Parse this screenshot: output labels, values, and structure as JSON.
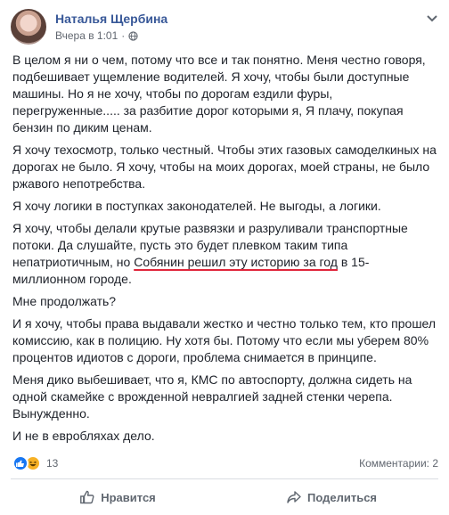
{
  "post": {
    "author": "Наталья Щербина",
    "time": "Вчера в 1:01",
    "separator": "·",
    "paragraphs": [
      "В целом я ни о чем, потому что все и так понятно. Меня честно говоря, подбешивает ущемление водителей. Я хочу, чтобы были доступные машины. Но я не хочу, чтобы по дорогам ездили фуры, перегруженные..... за разбитие дорог которыми я, Я плачу, покупая бензин по диким ценам.",
      "Я хочу техосмотр, только честный. Чтобы этих газовых самоделкиных на дорогах не было. Я хочу, чтобы на моих дорогах, моей страны, не было ржавого непотребства.",
      "Я хочу логики в поступках законодателей. Не выгоды, а логики."
    ],
    "paragraph4": {
      "before": "Я хочу, чтобы делали крутые развязки и разруливали транспортные потоки. Да слушайте, пусть это будет плевком таким типа непатриотичным, но ",
      "underlined": "Собянин решил эту историю за год",
      "after": " в 15-миллионном городе."
    },
    "paragraphs_rest": [
      "Мне продолжать?",
      "И я хочу, чтобы права выдавали жестко и честно только тем, кто прошел комиссию, как в полицию. Ну хотя бы. Потому что если мы уберем 80% процентов идиотов с дороги, проблема снимается в принципе.",
      "Меня дико выбешивает, что я, КМС по автоспорту, должна сидеть на одной скамейке с врожденной невралгией задней стенки черепа. Вынужденно.",
      "И не в евробляхах дело."
    ]
  },
  "footer": {
    "reactions_count": "13",
    "comments": "Комментарии: 2",
    "like_label": "Нравится",
    "share_label": "Поделиться"
  },
  "icons": {
    "privacy": "globe-icon",
    "menu": "chevron-down-icon",
    "like": "thumbs-up-icon",
    "share": "share-arrow-icon"
  },
  "colors": {
    "author": "#385898",
    "underline": "#e0263b",
    "like_reaction": "#1877f2",
    "haha_reaction": "#f7b125"
  }
}
